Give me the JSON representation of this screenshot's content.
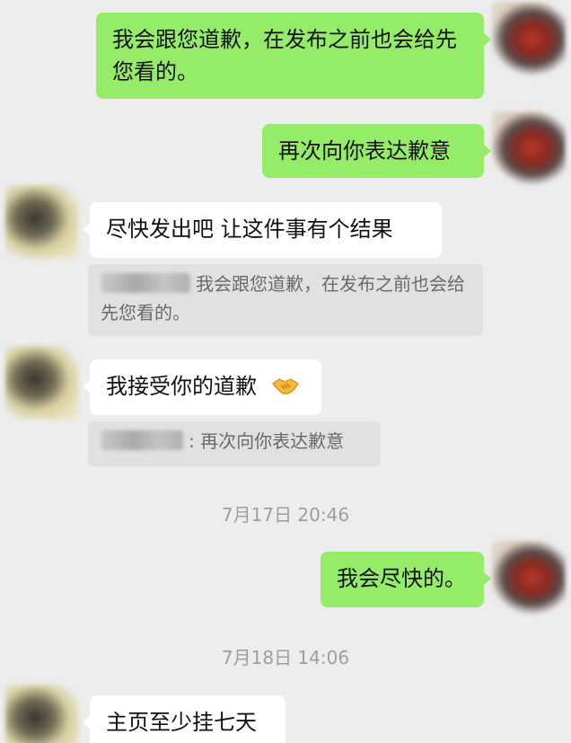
{
  "messages": [
    {
      "sender": "self",
      "text": "我会跟您道歉，在发布之前也会给先您看的。"
    },
    {
      "sender": "self",
      "text": "再次向你表达歉意"
    },
    {
      "sender": "other",
      "text": "尽快发出吧 让这件事有个结果",
      "quote": {
        "author": "",
        "text": "我会跟您道歉，在发布之前也会给先您看的。"
      }
    },
    {
      "sender": "other",
      "text": "我接受你的道歉",
      "emoji": "handshake-emoji",
      "quote": {
        "author": "",
        "text": "再次向你表达歉意"
      }
    },
    {
      "sender": "self",
      "text": "我会尽快的。"
    },
    {
      "sender": "other",
      "text": "主页至少挂七天"
    }
  ],
  "timestamps": [
    "7月17日 20:46",
    "7月18日 14:06"
  ],
  "colors": {
    "background": "#ededed",
    "self_bubble": "#95ec69",
    "other_bubble": "#ffffff",
    "quote_bg": "#e1e1e1",
    "timestamp_text": "#9e9e9e"
  },
  "quote_separator": ":"
}
